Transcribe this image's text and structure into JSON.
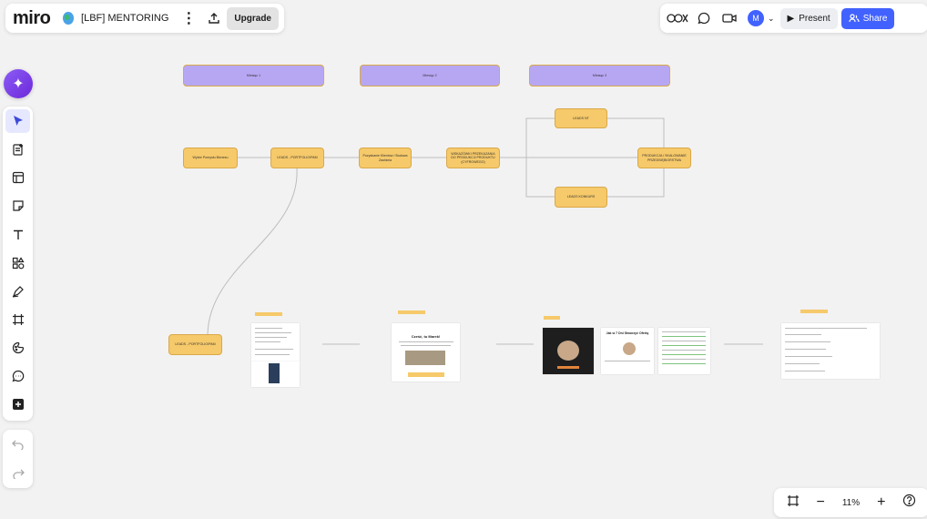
{
  "app": {
    "logo": "miro",
    "board_title": "[LBF] MENTORING",
    "upgrade_label": "Upgrade",
    "present_label": "Present",
    "share_label": "Share",
    "avatar_initial": "M",
    "zoom_level": "11%"
  },
  "toolbar": {
    "tools": [
      {
        "name": "select",
        "icon": "cursor-icon"
      },
      {
        "name": "templates",
        "icon": "doc-add-icon"
      },
      {
        "name": "frames",
        "icon": "layout-icon"
      },
      {
        "name": "sticky-note",
        "icon": "sticky-note-icon"
      },
      {
        "name": "text",
        "icon": "text-icon"
      },
      {
        "name": "shapes",
        "icon": "shapes-icon"
      },
      {
        "name": "pen",
        "icon": "pen-icon"
      },
      {
        "name": "frame",
        "icon": "frame-icon"
      },
      {
        "name": "stickers",
        "icon": "sticker-icon"
      },
      {
        "name": "comment",
        "icon": "comment-icon"
      },
      {
        "name": "more",
        "icon": "plus-icon"
      }
    ]
  },
  "colors": {
    "accent": "#4262ff",
    "node_yellow": "#f6c96a",
    "node_purple": "#b7a7f3",
    "canvas": "#f2f2f2"
  },
  "board": {
    "headers": [
      "Miesiąc 1",
      "Miesiąc 2",
      "Miesiąc 3"
    ],
    "nodes": {
      "n1": "Wybór Pomysłu Biznesu",
      "n2": "LEADS - PORTFOLIO/PAM",
      "n3": "Pozyskanie Klientów / Budowa Zaufania",
      "n4": "WSKAZÓWKI PRZEKAZANIA DO PRODUKCJI PRODUKTU (CYFROWEGO)",
      "n5": "LEADS NT",
      "n6": "LEADS KONKURS",
      "n7": "PRODUKCJA / SKALOWANIE PRZEDSIĘBIORSTWA",
      "n8": "LEADS - PORTFOLIO/PAM"
    },
    "thumb_title": "Cześć, tu Marek!",
    "thumb_title_2": "Jak w 7 Dni Stworzyć Ofertę"
  }
}
